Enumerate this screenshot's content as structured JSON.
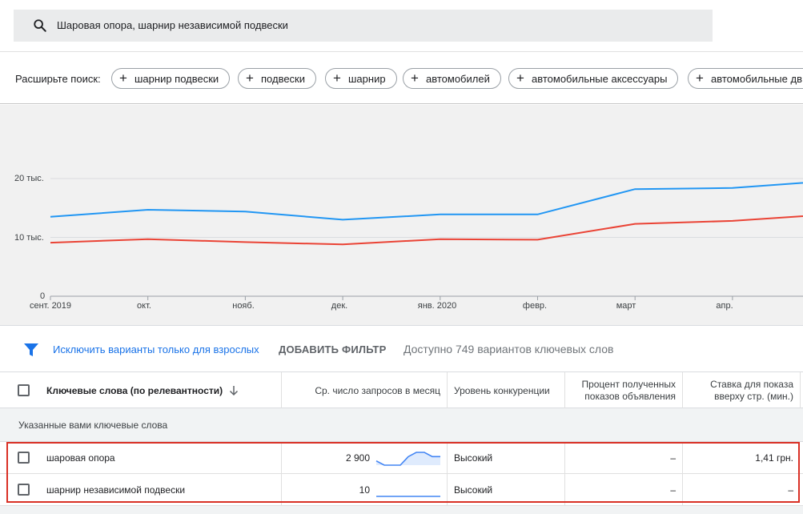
{
  "search": {
    "query": "Шаровая опора, шарнир независимой подвески"
  },
  "expand": {
    "label": "Расширьте поиск:",
    "chips": [
      "шарнир подвески",
      "подвески",
      "шарнир",
      "автомобилей",
      "автомобильные аксессуары",
      "автомобильные дв"
    ]
  },
  "chart_data": {
    "type": "line",
    "x": [
      "сент. 2019",
      "окт.",
      "нояб.",
      "дек.",
      "янв. 2020",
      "февр.",
      "март",
      "апр.",
      ""
    ],
    "yticks": [
      "0",
      "10 тыс.",
      "20 тыс."
    ],
    "ylim": [
      0,
      20000
    ],
    "series": [
      {
        "values": [
          13500,
          14700,
          14400,
          13000,
          13900,
          13900,
          18200,
          18400,
          19600
        ],
        "color": "#2196f3"
      },
      {
        "values": [
          9100,
          9700,
          9200,
          8800,
          9700,
          9600,
          12300,
          12800,
          13900
        ],
        "color": "#ea4335"
      }
    ]
  },
  "filter": {
    "adult_link": "Исключить варианты только для взрослых",
    "add_filter": "ДОБАВИТЬ ФИЛЬТР",
    "available": "Доступно 749 вариантов ключевых слов"
  },
  "table": {
    "headers": {
      "keyword": "Ключевые слова (по релевантности)",
      "searches": "Ср. число запросов в месяц",
      "competition": "Уровень конкуренции",
      "impr_share_1": "Процент полученных",
      "impr_share_2": "показов объявления",
      "bid_1": "Ставка для показа",
      "bid_2": "вверху стр. (мин.)"
    },
    "group_label": "Указанные вами ключевые слова",
    "rows": [
      {
        "keyword": "шаровая опора",
        "searches": "2 900",
        "competition": "Высокий",
        "impr_share": "–",
        "bid": "1,41 грн.",
        "trend": [
          1,
          0,
          0,
          0,
          2,
          3,
          3,
          2,
          2
        ]
      },
      {
        "keyword": "шарнир независимой подвески",
        "searches": "10",
        "competition": "Высокий",
        "impr_share": "–",
        "bid": "–",
        "trend": [
          0,
          0,
          0,
          0,
          0,
          0,
          0,
          0,
          0
        ]
      }
    ]
  },
  "colors": {
    "accent": "#1a73e8",
    "series_a": "#2196f3",
    "series_b": "#ea4335",
    "highlight": "#d93025"
  }
}
